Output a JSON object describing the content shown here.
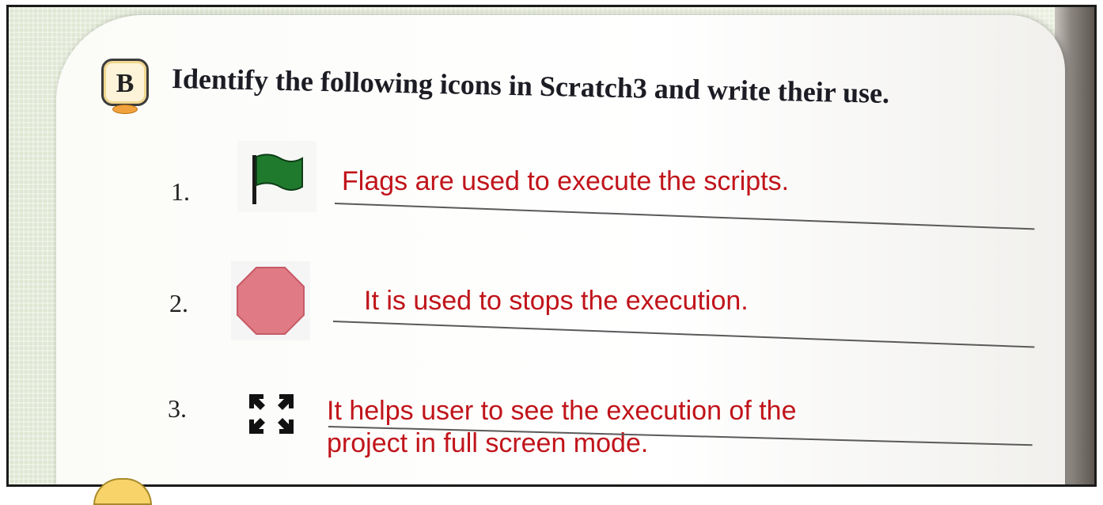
{
  "section": {
    "badge_letter": "B",
    "heading": "Identify the following icons in Scratch3 and write their use."
  },
  "items": [
    {
      "number": "1.",
      "icon": "green-flag-icon",
      "answer": "Flags are used to execute the scripts."
    },
    {
      "number": "2.",
      "icon": "stop-sign-icon",
      "answer": "It is used to stops the execution."
    },
    {
      "number": "3.",
      "icon": "full-screen-icon",
      "answer_line1": "It helps user to see the execution of the",
      "answer_line2": "project in full screen mode."
    }
  ],
  "colors": {
    "answer_text": "#c0141a",
    "flag": "#1f7a2e",
    "stop": "#e07a85"
  }
}
